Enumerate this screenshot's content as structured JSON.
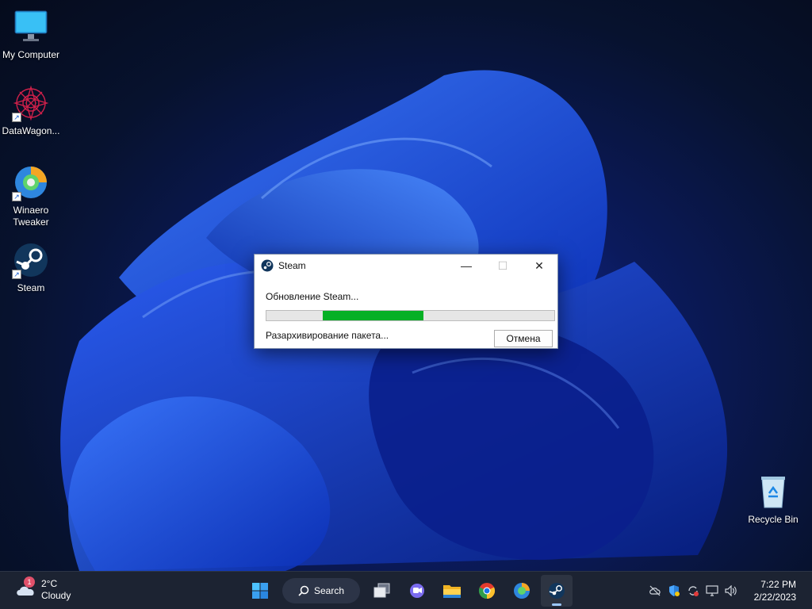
{
  "desktop": {
    "icons": [
      {
        "label": "My Computer"
      },
      {
        "label": "DataWagon..."
      },
      {
        "label": "Winaero Tweaker"
      },
      {
        "label": "Steam"
      },
      {
        "label": "Recycle Bin"
      }
    ]
  },
  "dialog": {
    "title": "Steam",
    "status": "Обновление Steam...",
    "progress_fraction": 0.35,
    "substatus": "Разархивирование пакета...",
    "cancel_label": "Отмена",
    "minimize_glyph": "—",
    "maximize_glyph": "☐",
    "close_glyph": "✕"
  },
  "taskbar": {
    "weather": {
      "temp": "2°C",
      "condition": "Cloudy",
      "badge": "1"
    },
    "search_label": "Search",
    "apps": [
      "start-icon",
      "task-view-icon",
      "teams-chat-icon",
      "file-explorer-icon",
      "chrome-icon",
      "winaero-tweaker-icon",
      "steam-icon"
    ],
    "tray_icons": [
      "cloud-off-icon",
      "defender-icon",
      "sync-error-icon",
      "network-icon",
      "volume-icon"
    ],
    "clock": {
      "time": "7:22 PM",
      "date": "2/22/2023"
    }
  },
  "colors": {
    "progress_fill": "#06b025",
    "taskbar": "#1c2332"
  }
}
